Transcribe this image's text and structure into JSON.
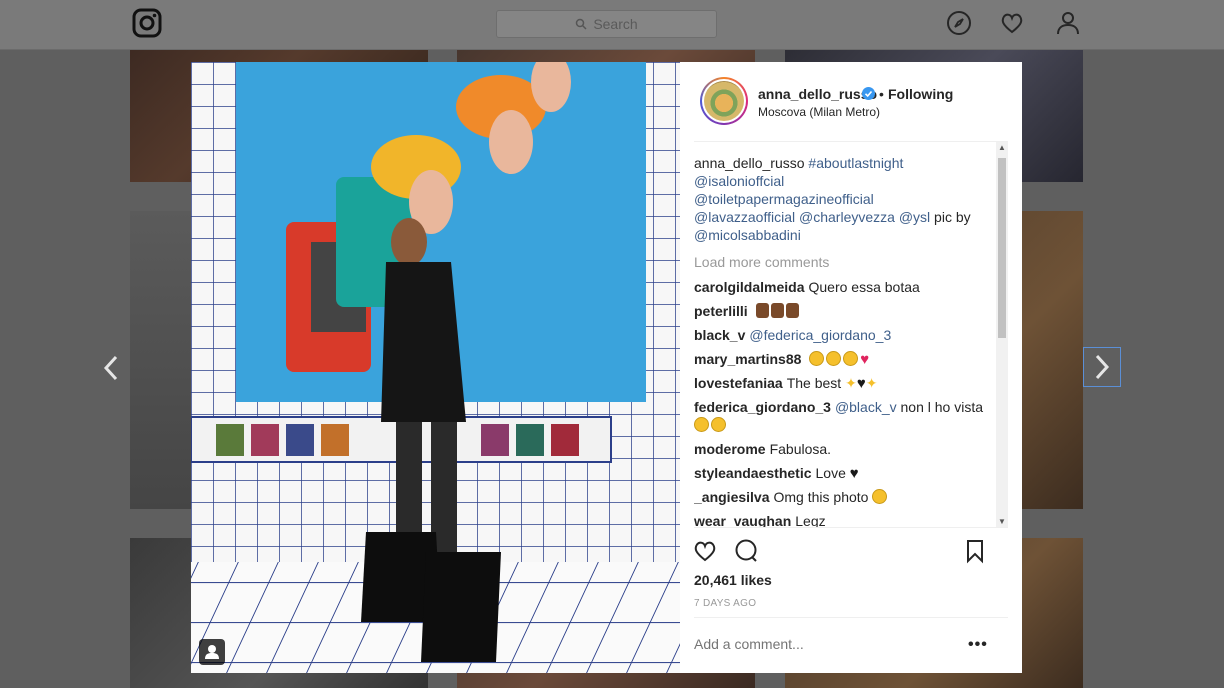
{
  "search": {
    "placeholder": "Search"
  },
  "post": {
    "username": "anna_dello_russo",
    "separator": "•",
    "follow_status": "Following",
    "location": "Moscova (Milan Metro)",
    "caption": {
      "user": "anna_dello_russo",
      "parts": [
        {
          "text": "#aboutlastnight",
          "link": true
        },
        {
          "text": "@isalonioffcial",
          "link": true
        },
        {
          "text": "@toiletpapermagazineofficial",
          "link": true
        },
        {
          "text": "@lavazzaofficial",
          "link": true
        },
        {
          "text": "@charleyvezza",
          "link": true
        },
        {
          "text": "@ysl",
          "link": true
        },
        {
          "text": "pic by",
          "link": false
        },
        {
          "text": "@micolsabbadini",
          "link": true
        }
      ]
    },
    "load_more": "Load more comments",
    "comments": [
      {
        "user": "carolgildalmeida",
        "text": "Quero essa botaa"
      },
      {
        "user": "peterlilli",
        "text": ""
      },
      {
        "user": "black_v",
        "mention": "@federica_giordano_3",
        "text": ""
      },
      {
        "user": "mary_martins88",
        "text": ""
      },
      {
        "user": "lovestefaniaa",
        "text": "The best"
      },
      {
        "user": "federica_giordano_3",
        "mention": "@black_v",
        "text": "non l ho vista"
      },
      {
        "user": "moderome",
        "text": "Fabulosa."
      },
      {
        "user": "styleandaesthetic",
        "text": "Love"
      },
      {
        "user": "_angiesilva",
        "text": "Omg this photo"
      },
      {
        "user": "wear_vaughan",
        "text": "Legz"
      }
    ],
    "likes": "20,461 likes",
    "date": "7 DAYS AGO",
    "add_comment_placeholder": "Add a comment...",
    "more": "•••"
  },
  "colors": {
    "link": "#3f5f8a",
    "verified": "#3897f0",
    "heart": "#e0245e"
  }
}
